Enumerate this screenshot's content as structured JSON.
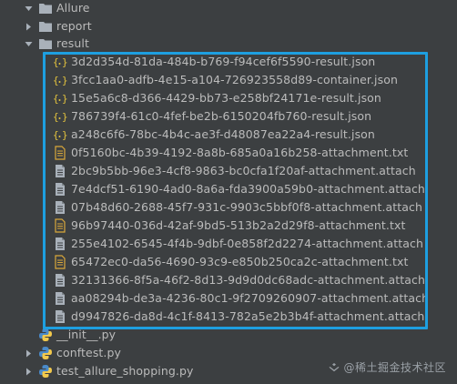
{
  "tree": {
    "root": {
      "label": "Allure"
    },
    "report": {
      "label": "report"
    },
    "result": {
      "label": "result"
    },
    "result_files": [
      {
        "label": "3d2d354d-81da-484b-b769-f94cef6f5590-result.json",
        "type": "json"
      },
      {
        "label": "3fcc1aa0-adfb-4e15-a104-726923558d89-container.json",
        "type": "json"
      },
      {
        "label": "15e5a6c8-d366-4429-bb73-e258bf24171e-result.json",
        "type": "json"
      },
      {
        "label": "786739f4-61c0-4fef-be2b-6150204fb760-result.json",
        "type": "json"
      },
      {
        "label": "a248c6f6-78bc-4b4c-ae3f-d48087ea22a4-result.json",
        "type": "json"
      },
      {
        "label": "0f5160bc-4b39-4192-8a8b-685a0a16b258-attachment.txt",
        "type": "txt"
      },
      {
        "label": "2bc9b5bb-96e3-4cf8-9863-bc0cfa1f20af-attachment.attach",
        "type": "attach"
      },
      {
        "label": "7e4dcf51-6190-4ad0-8a6a-fda3900a59b0-attachment.attach",
        "type": "attach"
      },
      {
        "label": "07b48d60-2688-45f7-931c-9903c5bbf0f8-attachment.attach",
        "type": "attach"
      },
      {
        "label": "96b97440-036d-42af-9bd5-513b2a2d29f8-attachment.txt",
        "type": "txt"
      },
      {
        "label": "255e4102-6545-4f4b-9dbf-0e858f2d2274-attachment.attach",
        "type": "attach"
      },
      {
        "label": "65472ec0-da56-4690-93c9-e850b250ca2c-attachment.txt",
        "type": "txt"
      },
      {
        "label": "32131366-8f5a-46f2-8d13-9d9d0dc68adc-attachment.attach",
        "type": "attach"
      },
      {
        "label": "aa08294b-de3a-4236-80c1-9f2709260907-attachment.attach",
        "type": "attach"
      },
      {
        "label": "d9947826-da8d-4c1f-8413-782a5e2b3b4f-attachment.attach",
        "type": "attach"
      }
    ],
    "py_files": [
      {
        "label": "__init__.py",
        "expandable": false
      },
      {
        "label": "conftest.py",
        "expandable": true
      },
      {
        "label": "test_allure_shopping.py",
        "expandable": true
      }
    ]
  },
  "watermark": {
    "text": "@稀土掘金技术社区"
  },
  "colors": {
    "background": "#3c3f41",
    "text": "#bbbbbb",
    "highlight": "#1e9fe0",
    "folder": "#a9b1ba",
    "json_icon": "#e3c33e",
    "txt_icon": "#d9a73b",
    "attach_icon": "#a9b1ba"
  }
}
